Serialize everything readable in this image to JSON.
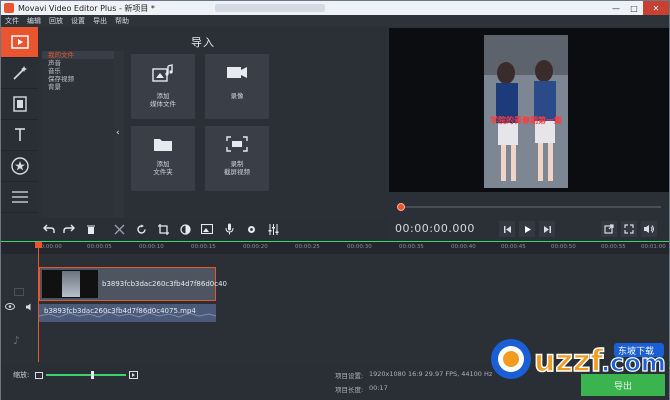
{
  "window": {
    "title": "Movavi Video Editor Plus - 新项目 *",
    "controls": {
      "minimize": "—",
      "maximize": "□",
      "close": "✕"
    }
  },
  "menu": [
    "文件",
    "编辑",
    "回放",
    "设置",
    "导出",
    "帮助"
  ],
  "rail": {
    "items": [
      "import-icon",
      "magic-wand-icon",
      "filmstrip-icon",
      "text-icon",
      "star-icon",
      "list-icon"
    ]
  },
  "import_panel": {
    "title": "导入",
    "tree": [
      "我的文件",
      "声音",
      "音乐",
      "保存视频",
      "背景"
    ],
    "tiles": [
      {
        "label": "添加\n媒体文件",
        "icon": "add-media-icon"
      },
      {
        "label": "录像",
        "icon": "camera-icon"
      },
      {
        "label": "添加\n文件夹",
        "icon": "folder-icon"
      },
      {
        "label": "录制\n截屏视频",
        "icon": "screen-capture-icon"
      }
    ]
  },
  "preview": {
    "overlay_text": "学院的青春期第一集",
    "timecode": "00:00:00.000"
  },
  "timeline": {
    "ruler": [
      "00:00:00",
      "00:00:05",
      "00:00:10",
      "00:00:15",
      "00:00:20",
      "00:00:25",
      "00:00:30",
      "00:00:35",
      "00:00:40",
      "00:00:45",
      "00:00:50",
      "00:00:55",
      "00:01:00"
    ],
    "video_clip": "b3893fcb3dac260c3fb4d7f86d0c40",
    "audio_clip": "b3893fcb3dac260c3fb4d7f86d0c4075.mp4"
  },
  "status": {
    "zoom_label": "缩放:",
    "project_settings_label": "项目设置:",
    "project_settings_value": "1920x1080 16:9 29.97 FPS, 44100 Hz",
    "project_length_label": "项目长度:",
    "project_length_value": "00:17",
    "export_label": "导出"
  },
  "watermark": {
    "text": "uzzf",
    "sub": "东坡下载",
    "domain": ".com"
  },
  "colors": {
    "accent": "#e8552f",
    "green": "#3bb34f",
    "bg": "#2b2f36"
  }
}
